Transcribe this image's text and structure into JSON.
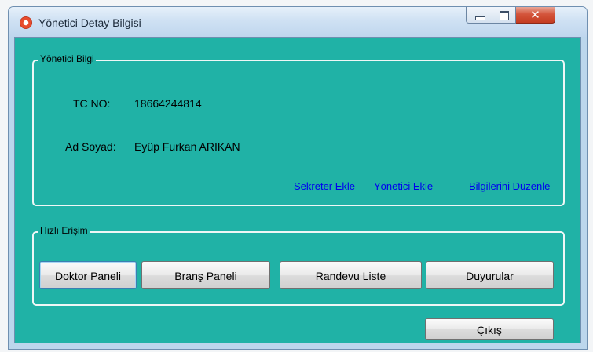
{
  "window": {
    "title": "Yönetici Detay Bilgisi",
    "close_glyph": "✕"
  },
  "info_group": {
    "title": "Yönetici Bilgi",
    "tc_label": "TC NO:",
    "tc_value": "18664244814",
    "name_label": "Ad Soyad:",
    "name_value": "Eyüp Furkan ARIKAN",
    "links": {
      "add_secretary": "Sekreter Ekle",
      "add_admin": "Yönetici Ekle",
      "edit_info": "Bilgilerini Düzenle"
    }
  },
  "quick_access": {
    "title": "Hızlı Erişim",
    "buttons": {
      "doctor_panel": "Doktor Paneli",
      "branch_panel": "Branş Paneli",
      "appointment_list": "Randevu Liste",
      "announcements": "Duyurular"
    }
  },
  "exit_label": "Çıkış",
  "colors": {
    "client_bg": "#20b2a6",
    "link": "#0000ee",
    "titlebar": "#cfe1f3"
  },
  "icons": {
    "app": "app-icon",
    "minimize": "minimize-icon",
    "maximize": "maximize-icon",
    "close": "close-icon"
  }
}
